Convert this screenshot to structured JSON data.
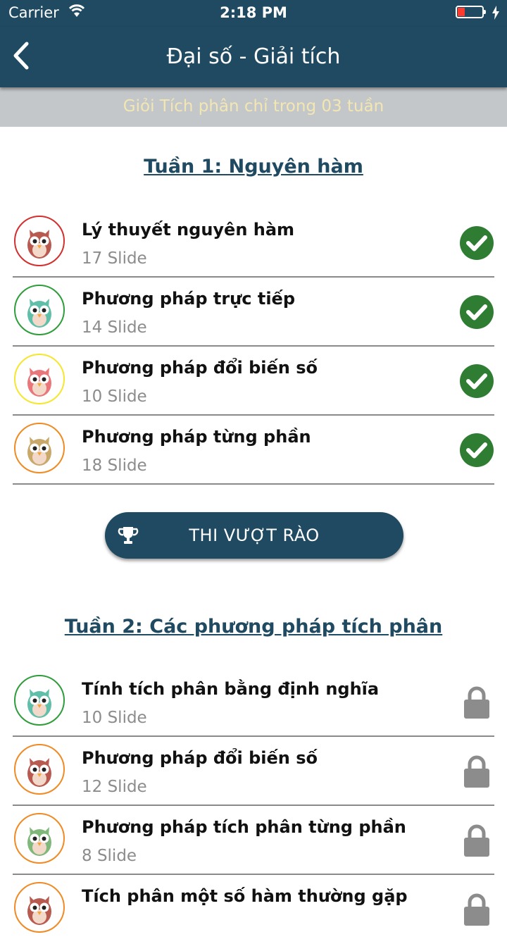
{
  "status_bar": {
    "carrier": "Carrier",
    "time": "2:18 PM"
  },
  "nav": {
    "title": "Đại số - Giải tích"
  },
  "subheader": {
    "text": "Giỏi Tích phân chỉ trong 03 tuần"
  },
  "week1": {
    "title": "Tuần 1: Nguyên hàm",
    "lessons": [
      {
        "title": "Lý thuyết nguyên hàm",
        "slides": "17 Slide",
        "status": "completed"
      },
      {
        "title": "Phương pháp trực tiếp",
        "slides": "14 Slide",
        "status": "completed"
      },
      {
        "title": "Phương pháp đổi biến số",
        "slides": "10 Slide",
        "status": "completed"
      },
      {
        "title": "Phương pháp từng phần",
        "slides": "18 Slide",
        "status": "completed"
      }
    ]
  },
  "exam_button": {
    "label": "THI VƯỢT RÀO",
    "icon": "trophy-icon"
  },
  "week2": {
    "title": "Tuần 2: Các phương pháp tích phân",
    "lessons": [
      {
        "title": "Tính tích phân bằng định nghĩa",
        "slides": "10 Slide",
        "status": "locked"
      },
      {
        "title": "Phương pháp đổi biến số",
        "slides": "12 Slide",
        "status": "locked"
      },
      {
        "title": "Phương pháp tích phân từng phần",
        "slides": "8 Slide",
        "status": "locked"
      },
      {
        "title": "Tích phân một số hàm thường gặp",
        "slides": "",
        "status": "locked"
      }
    ]
  },
  "colors": {
    "header": "#1f4a61",
    "subheader_bg": "#c4c7c9",
    "subheader_text": "#f2e6b3",
    "check_green": "#2e7d32",
    "lock_gray": "#8c8c8c",
    "owl_ring_colors": [
      "#d32f2f",
      "#2e9d3a",
      "#f5e62e",
      "#f08a24",
      "#2e9d3a",
      "#f08a24",
      "#f08a24",
      "#f08a24"
    ]
  }
}
